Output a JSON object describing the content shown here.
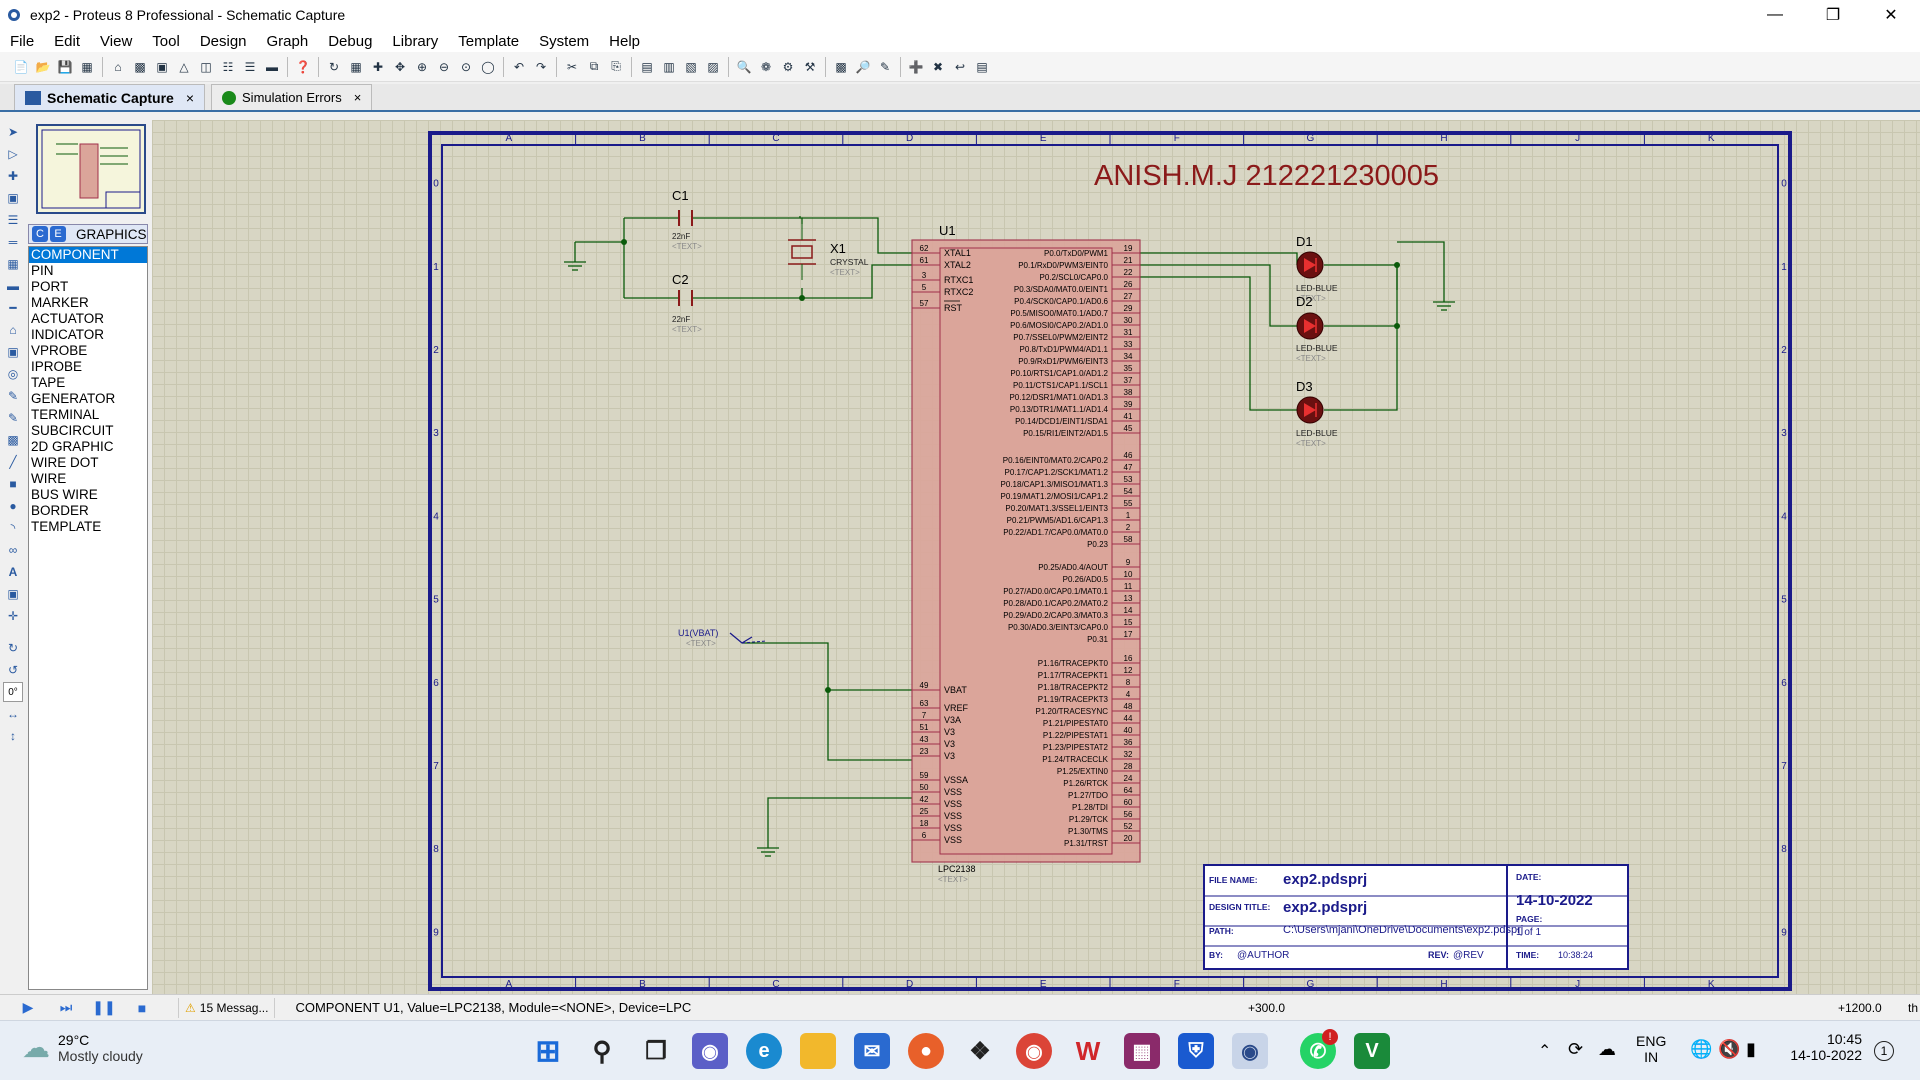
{
  "window": {
    "title": "exp2 - Proteus 8 Professional - Schematic Capture"
  },
  "menu": [
    "File",
    "Edit",
    "View",
    "Tool",
    "Design",
    "Graph",
    "Debug",
    "Library",
    "Template",
    "System",
    "Help"
  ],
  "tabs": [
    {
      "label": "Schematic Capture",
      "close": "×"
    },
    {
      "label": "Simulation Errors",
      "close": "×"
    }
  ],
  "picker": {
    "buttons": [
      "C",
      "E"
    ],
    "header": "GRAPHICS",
    "items": [
      "COMPONENT",
      "PIN",
      "PORT",
      "MARKER",
      "ACTUATOR",
      "INDICATOR",
      "VPROBE",
      "IPROBE",
      "TAPE",
      "GENERATOR",
      "TERMINAL",
      "SUBCIRCUIT",
      "2D GRAPHIC",
      "WIRE DOT",
      "WIRE",
      "BUS WIRE",
      "BORDER",
      "TEMPLATE"
    ],
    "selected": "COMPONENT"
  },
  "rotation": "0°",
  "schematic": {
    "heading": "ANISH.M.J  212221230005",
    "col_labels": [
      "A",
      "B",
      "C",
      "D",
      "E",
      "F",
      "G",
      "H",
      "J",
      "K"
    ],
    "row_labels": [
      "0",
      "1",
      "2",
      "3",
      "4",
      "5",
      "6",
      "7",
      "8",
      "9"
    ],
    "c1": {
      "ref": "C1",
      "value": "22nF",
      "text": "<TEXT>"
    },
    "c2": {
      "ref": "C2",
      "value": "22nF",
      "text": "<TEXT>"
    },
    "x1": {
      "ref": "X1",
      "value": "CRYSTAL",
      "text": "<TEXT>"
    },
    "u1": {
      "ref": "U1",
      "part": "LPC2138",
      "text": "<TEXT>"
    },
    "d1": {
      "ref": "D1",
      "value": "LED-BLUE",
      "text": "<TEXT>"
    },
    "d2": {
      "ref": "D2",
      "value": "LED-BLUE",
      "text": "<TEXT>"
    },
    "d3": {
      "ref": "D3",
      "value": "LED-BLUE",
      "text": "<TEXT>"
    },
    "vbat": {
      "label": "U1(VBAT)",
      "text": "<TEXT>"
    },
    "left_pins": [
      {
        "num": "62",
        "name": "XTAL1"
      },
      {
        "num": "61",
        "name": "XTAL2"
      },
      {
        "num": "3",
        "name": "RTXC1"
      },
      {
        "num": "5",
        "name": "RTXC2"
      },
      {
        "num": "57",
        "name": "RST"
      },
      {
        "num": "49",
        "name": "VBAT"
      },
      {
        "num": "63",
        "name": "VREF"
      },
      {
        "num": "7",
        "name": "V3A"
      },
      {
        "num": "51",
        "name": "V3"
      },
      {
        "num": "43",
        "name": "V3"
      },
      {
        "num": "23",
        "name": "V3"
      },
      {
        "num": "59",
        "name": "VSSA"
      },
      {
        "num": "50",
        "name": "VSS"
      },
      {
        "num": "42",
        "name": "VSS"
      },
      {
        "num": "25",
        "name": "VSS"
      },
      {
        "num": "18",
        "name": "VSS"
      },
      {
        "num": "6",
        "name": "VSS"
      }
    ],
    "right_pins_p0a": [
      {
        "num": "19",
        "name": "P0.0/TxD0/PWM1"
      },
      {
        "num": "21",
        "name": "P0.1/RxD0/PWM3/EINT0"
      },
      {
        "num": "22",
        "name": "P0.2/SCL0/CAP0.0"
      },
      {
        "num": "26",
        "name": "P0.3/SDA0/MAT0.0/EINT1"
      },
      {
        "num": "27",
        "name": "P0.4/SCK0/CAP0.1/AD0.6"
      },
      {
        "num": "29",
        "name": "P0.5/MISO0/MAT0.1/AD0.7"
      },
      {
        "num": "30",
        "name": "P0.6/MOSI0/CAP0.2/AD1.0"
      },
      {
        "num": "31",
        "name": "P0.7/SSEL0/PWM2/EINT2"
      },
      {
        "num": "33",
        "name": "P0.8/TxD1/PWM4/AD1.1"
      },
      {
        "num": "34",
        "name": "P0.9/RxD1/PWM6/EINT3"
      },
      {
        "num": "35",
        "name": "P0.10/RTS1/CAP1.0/AD1.2"
      },
      {
        "num": "37",
        "name": "P0.11/CTS1/CAP1.1/SCL1"
      },
      {
        "num": "38",
        "name": "P0.12/DSR1/MAT1.0/AD1.3"
      },
      {
        "num": "39",
        "name": "P0.13/DTR1/MAT1.1/AD1.4"
      },
      {
        "num": "41",
        "name": "P0.14/DCD1/EINT1/SDA1"
      },
      {
        "num": "45",
        "name": "P0.15/RI1/EINT2/AD1.5"
      }
    ],
    "right_pins_p0b": [
      {
        "num": "46",
        "name": "P0.16/EINT0/MAT0.2/CAP0.2"
      },
      {
        "num": "47",
        "name": "P0.17/CAP1.2/SCK1/MAT1.2"
      },
      {
        "num": "53",
        "name": "P0.18/CAP1.3/MISO1/MAT1.3"
      },
      {
        "num": "54",
        "name": "P0.19/MAT1.2/MOSI1/CAP1.2"
      },
      {
        "num": "55",
        "name": "P0.20/MAT1.3/SSEL1/EINT3"
      },
      {
        "num": "1",
        "name": "P0.21/PWM5/AD1.6/CAP1.3"
      },
      {
        "num": "2",
        "name": "P0.22/AD1.7/CAP0.0/MAT0.0"
      },
      {
        "num": "58",
        "name": "P0.23"
      }
    ],
    "right_pins_p0c": [
      {
        "num": "9",
        "name": "P0.25/AD0.4/AOUT"
      },
      {
        "num": "10",
        "name": "P0.26/AD0.5"
      },
      {
        "num": "11",
        "name": "P0.27/AD0.0/CAP0.1/MAT0.1"
      },
      {
        "num": "13",
        "name": "P0.28/AD0.1/CAP0.2/MAT0.2"
      },
      {
        "num": "14",
        "name": "P0.29/AD0.2/CAP0.3/MAT0.3"
      },
      {
        "num": "15",
        "name": "P0.30/AD0.3/EINT3/CAP0.0"
      },
      {
        "num": "17",
        "name": "P0.31"
      }
    ],
    "right_pins_p1": [
      {
        "num": "16",
        "name": "P1.16/TRACEPKT0"
      },
      {
        "num": "12",
        "name": "P1.17/TRACEPKT1"
      },
      {
        "num": "8",
        "name": "P1.18/TRACEPKT2"
      },
      {
        "num": "4",
        "name": "P1.19/TRACEPKT3"
      },
      {
        "num": "48",
        "name": "P1.20/TRACESYNC"
      },
      {
        "num": "44",
        "name": "P1.21/PIPESTAT0"
      },
      {
        "num": "40",
        "name": "P1.22/PIPESTAT1"
      },
      {
        "num": "36",
        "name": "P1.23/PIPESTAT2"
      },
      {
        "num": "32",
        "name": "P1.24/TRACECLK"
      },
      {
        "num": "28",
        "name": "P1.25/EXTIN0"
      },
      {
        "num": "24",
        "name": "P1.26/RTCK"
      },
      {
        "num": "64",
        "name": "P1.27/TDO"
      },
      {
        "num": "60",
        "name": "P1.28/TDI"
      },
      {
        "num": "56",
        "name": "P1.29/TCK"
      },
      {
        "num": "52",
        "name": "P1.30/TMS"
      },
      {
        "num": "20",
        "name": "P1.31/TRST"
      }
    ],
    "title_block": {
      "file_name_label": "FILE NAME:",
      "file_name": "exp2.pdsprj",
      "date_label": "DATE:",
      "date": "14-10-2022",
      "design_title_label": "DESIGN TITLE:",
      "design_title": "exp2.pdsprj",
      "page_label": "PAGE:",
      "page": "1",
      "page_of": "1 of 1",
      "path_label": "PATH:",
      "path": "C:\\Users\\mjani\\OneDrive\\Documents\\exp2.pdsprj",
      "by_label": "BY:",
      "by": "@AUTHOR",
      "rev_label": "REV:",
      "rev": "@REV",
      "time_label": "TIME:",
      "time": "10:38:24"
    }
  },
  "status": {
    "messages": "15 Messag...",
    "info": "COMPONENT U1, Value=LPC2138, Module=<NONE>, Device=LPC",
    "coord1": "+300.0",
    "coord2": "+1200.0",
    "units": "th"
  },
  "taskbar": {
    "weather_temp": "29°C",
    "weather_desc": "Mostly cloudy",
    "lang1": "ENG",
    "lang2": "IN",
    "time": "10:45",
    "date": "14-10-2022",
    "notif": "1"
  },
  "colors": {
    "accent": "#0078d7",
    "wire": "#0a5a0a",
    "chip_fill": "#dba59a",
    "chip_border": "#a0304a",
    "heading": "#8b1a1a",
    "frame": "#1a1a8a"
  }
}
